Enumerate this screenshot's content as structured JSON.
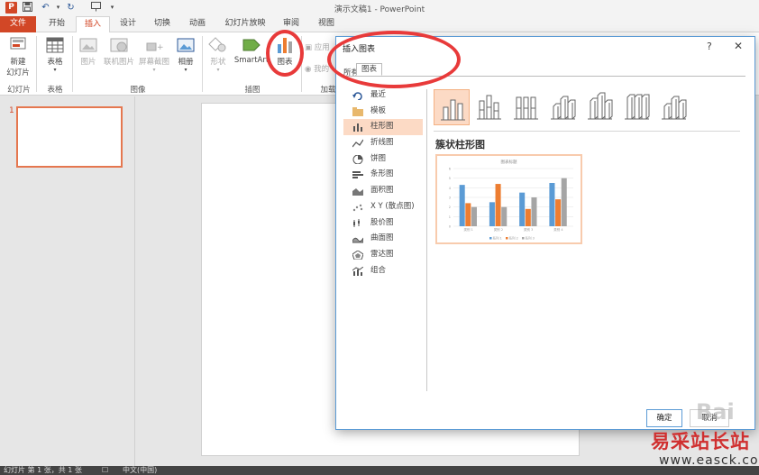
{
  "window": {
    "title": "演示文稿1 - PowerPoint",
    "app_icon": "P"
  },
  "qat": {
    "undo_icon": "↶",
    "redo_icon": "↻",
    "more_icon": "▾"
  },
  "tabs": [
    "文件",
    "开始",
    "插入",
    "设计",
    "切换",
    "动画",
    "幻灯片放映",
    "审阅",
    "视图"
  ],
  "ribbon": {
    "new_slide": "新建\n幻灯片",
    "new_slide_label_top": "新建",
    "new_slide_label_bottom": "幻灯片",
    "table": "表格",
    "picture": "图片",
    "online_picture": "联机图片",
    "screenshot": "屏幕截图",
    "album": "相册",
    "shapes": "形状",
    "smartart": "SmartArt",
    "chart": "图表",
    "apps": "应用",
    "my_apps": "我的",
    "groups": {
      "slides": "幻灯片",
      "tables": "表格",
      "images": "图像",
      "illustrations": "插图",
      "addins": "加载"
    }
  },
  "thumbnail": {
    "slide_number": "1"
  },
  "dialog": {
    "title": "插入图表",
    "help": "?",
    "close": "✕",
    "tab_recent": "所有",
    "tab_all": "图表",
    "types": [
      {
        "label": "最近",
        "icon": "recent-icon"
      },
      {
        "label": "模板",
        "icon": "folder-icon"
      },
      {
        "label": "柱形图",
        "icon": "column-chart-icon",
        "selected": true
      },
      {
        "label": "折线图",
        "icon": "line-chart-icon"
      },
      {
        "label": "饼图",
        "icon": "pie-chart-icon"
      },
      {
        "label": "条形图",
        "icon": "bar-chart-icon"
      },
      {
        "label": "面积图",
        "icon": "area-chart-icon"
      },
      {
        "label": "X Y (散点图)",
        "icon": "scatter-chart-icon"
      },
      {
        "label": "股价图",
        "icon": "stock-chart-icon"
      },
      {
        "label": "曲面图",
        "icon": "surface-chart-icon"
      },
      {
        "label": "雷达图",
        "icon": "radar-chart-icon"
      },
      {
        "label": "组合",
        "icon": "combo-chart-icon"
      }
    ],
    "subtype_name": "簇状柱形图",
    "preview_title": "图表标题",
    "ok": "确定",
    "cancel": "取消"
  },
  "chart_data": {
    "type": "bar",
    "title": "图表标题",
    "categories": [
      "类别 1",
      "类别 2",
      "类别 3",
      "类别 4"
    ],
    "series": [
      {
        "name": "系列 1",
        "values": [
          4.3,
          2.5,
          3.5,
          4.5
        ]
      },
      {
        "name": "系列 2",
        "values": [
          2.4,
          4.4,
          1.8,
          2.8
        ]
      },
      {
        "name": "系列 3",
        "values": [
          2.0,
          2.0,
          3.0,
          5.0
        ]
      }
    ],
    "ylim": [
      0,
      6
    ],
    "colors": [
      "#5b9bd5",
      "#ed7d31",
      "#a5a5a5"
    ],
    "legend": "bottom",
    "grid": true
  },
  "status": {
    "slide_info": "幻灯片 第 1 张，共 1 张",
    "language": "中文(中国)"
  },
  "watermark": {
    "baidu": "Bai",
    "site": "易采站长站",
    "url": "www.easck.com"
  },
  "colors": {
    "accent": "#d24726",
    "selection": "#fcdac5",
    "annotation": "#e83a3a"
  }
}
